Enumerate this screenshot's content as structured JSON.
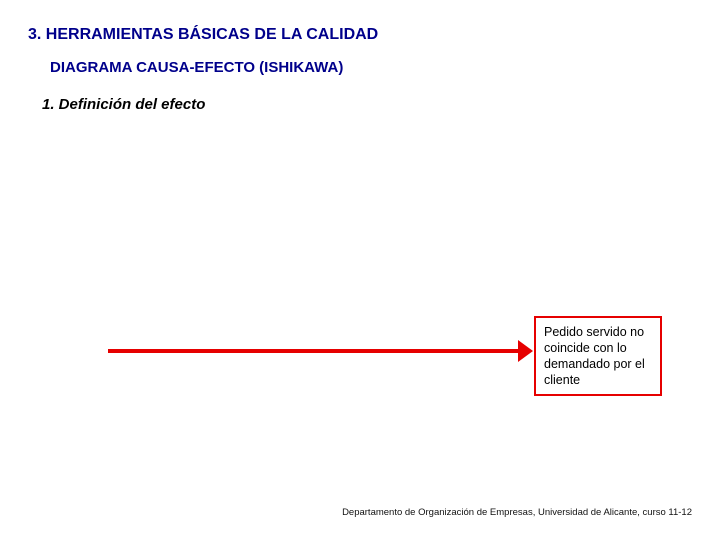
{
  "title": "3. HERRAMIENTAS BÁSICAS DE LA CALIDAD",
  "subtitle": "DIAGRAMA CAUSA-EFECTO (ISHIKAWA)",
  "step": "1. Definición del efecto",
  "effect": "Pedido servido no coincide con lo demandado por el cliente",
  "footer": "Departamento de Organización de Empresas, Universidad de Alicante, curso 11-12",
  "colors": {
    "heading": "#00008b",
    "accent": "#e60000"
  }
}
